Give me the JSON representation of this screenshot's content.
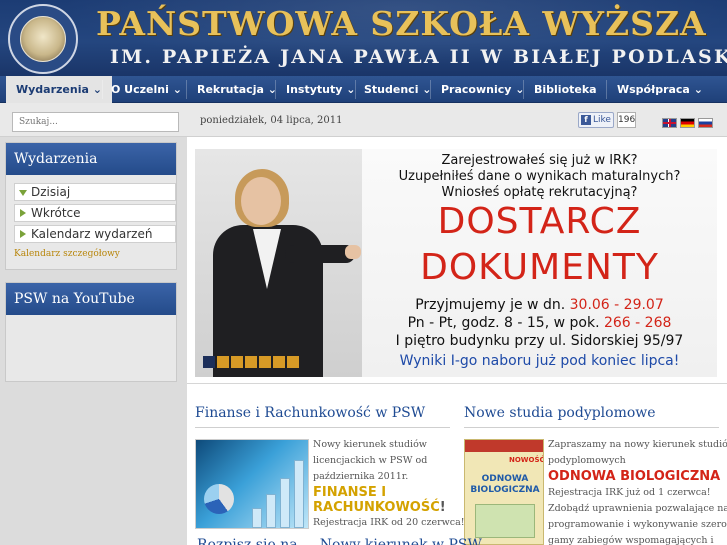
{
  "header": {
    "title_line1": "PAŃSTWOWA SZKOŁA WYŻSZA",
    "title_line2": "IM. PAPIEŻA JANA PAWŁA II W BIAŁEJ PODLASKIEJ"
  },
  "nav": {
    "items": [
      {
        "label": "Wydarzenia ⌄"
      },
      {
        "label": "O Uczelni ⌄"
      },
      {
        "label": "Rekrutacja ⌄"
      },
      {
        "label": "Instytuty ⌄"
      },
      {
        "label": "Studenci ⌄"
      },
      {
        "label": "Pracownicy ⌄"
      },
      {
        "label": "Biblioteka"
      },
      {
        "label": "Współpraca ⌄"
      }
    ]
  },
  "search": {
    "placeholder": "Szukaj..."
  },
  "date": "poniedziałek, 04 lipca, 2011",
  "facebook": {
    "like_label": "Like",
    "count": "196"
  },
  "sidebar": {
    "events_title": "Wydarzenia",
    "events_items": [
      {
        "label": "Dzisiaj"
      },
      {
        "label": "Wkrótce"
      },
      {
        "label": "Kalendarz wydarzeń"
      }
    ],
    "calendar_link": "Kalendarz szczegółowy",
    "youtube_title": "PSW na YouTube"
  },
  "banner": {
    "line1": "Zarejestrowałeś się już w IRK?",
    "line2": "Uzupełniłeś dane o wynikach maturalnych?",
    "line3": "Wniosłeś opłatę rekrutacyjną?",
    "big1": "DOSTARCZ",
    "big2": "DOKUMENTY",
    "line4a": "Przyjmujemy je w dn. ",
    "line4b": "30.06 - 29.07",
    "line5a": "Pn - Pt, godz. 8 - 15, w pok. ",
    "line5b": "266 - 268",
    "line6": "I piętro budynku przy ul. Sidorskiej 95/97",
    "line7": "Wyniki I-go naboru już pod koniec lipca!",
    "slide_count": 7,
    "active_slide": 1
  },
  "articles": {
    "left_title": "Finanse i Rachunkowość w PSW",
    "left_lines": [
      "Nowy kierunek studiów",
      "licencjackich w PSW od",
      "października 2011r."
    ],
    "left_highlight1": "FINANSE I",
    "left_highlight2": "RACHUNKOWOŚĆ",
    "left_highlight_suffix": "!",
    "left_last": "Rejestracja IRK od 20 czerwca!",
    "right_title": "Nowe studia podyplomowe",
    "right_lines": [
      "Zapraszamy na nowy kierunek studiów",
      "podyplomowych"
    ],
    "right_highlight": "ODNOWA BIOLOGICZNA",
    "right_more": [
      "Rejestracja IRK już od 1 czerwca!",
      "Zdobądź uprawnienia pozwalające na",
      "programowanie i wykonywanie szerokiej",
      "gamy zabiegów wspomagających i"
    ],
    "thumb2_label1": "NOWOŚĆ!",
    "thumb2_label2": "ODNOWA BIOLOGICZNA",
    "bottom_title": "Rozpisz się na ... Nowy kierunek w PSW"
  },
  "colors": {
    "header_bg": "#1c3c74",
    "gold": "#e8c15a",
    "accent_red": "#d32418",
    "link_blue": "#1f4b93"
  }
}
